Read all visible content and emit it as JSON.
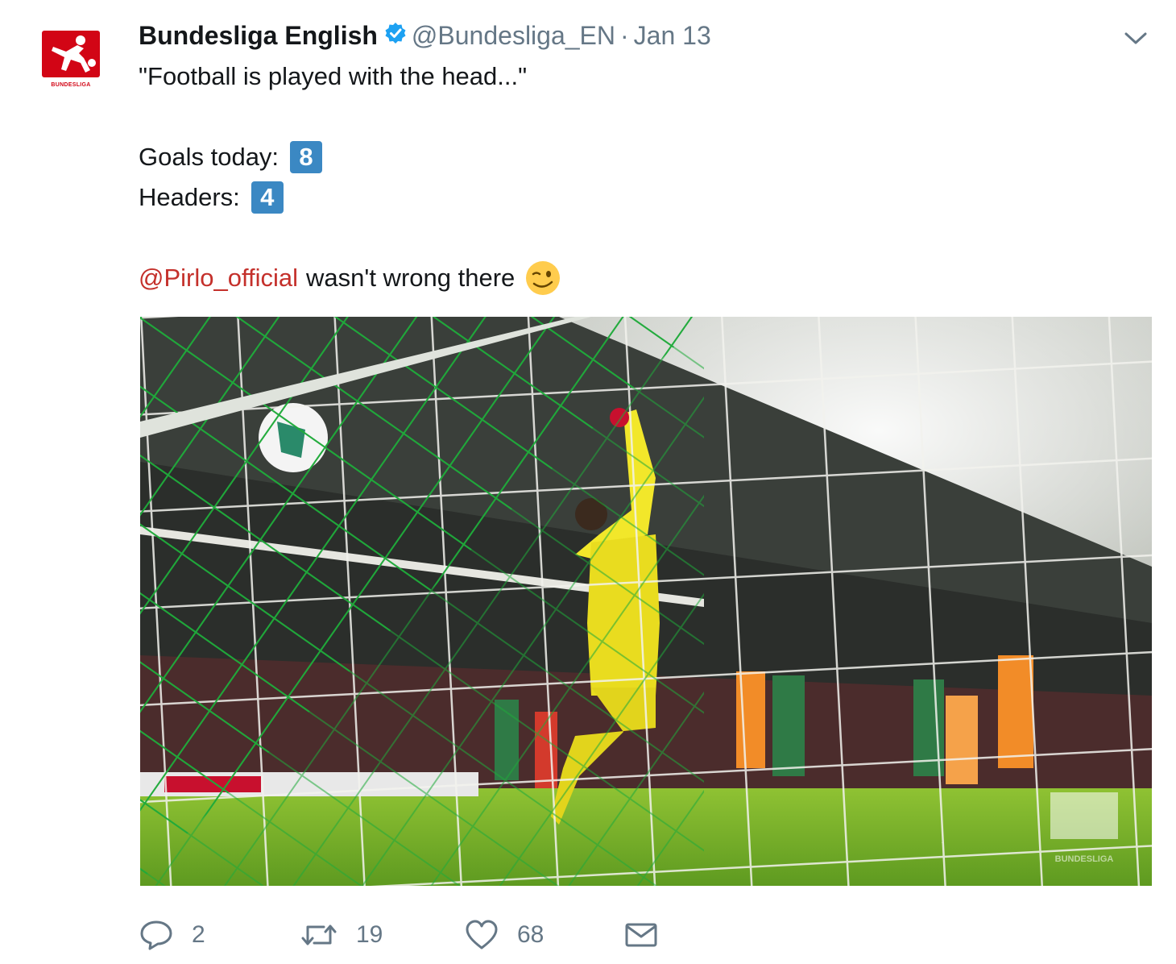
{
  "account": {
    "logo_text": "BUNDESLIGA",
    "name": "Bundesliga English",
    "handle": "@Bundesliga_EN",
    "separator": "·",
    "date": "Jan 13"
  },
  "tweet": {
    "line1": "\"Football is played with the head...\"",
    "goals_label": "Goals today:",
    "goals_value": "8",
    "headers_label": "Headers:",
    "headers_value": "4",
    "mention": "@Pirlo_official",
    "tail": "wasn't wrong there"
  },
  "media": {
    "watermark": "BUNDESLIGA"
  },
  "actions": {
    "replies": "2",
    "retweets": "19",
    "likes": "68"
  },
  "icons": {
    "verified": "verified-badge-icon",
    "chevron": "chevron-down-icon",
    "reply": "reply-icon",
    "retweet": "retweet-icon",
    "like": "heart-icon",
    "dm": "envelope-icon",
    "emoji": "winking-face-icon"
  },
  "colors": {
    "brand_red": "#d20515",
    "mention": "#c4302b",
    "verified_blue": "#1da1f2",
    "keycap_blue": "#3b88c3",
    "muted": "#657786"
  }
}
